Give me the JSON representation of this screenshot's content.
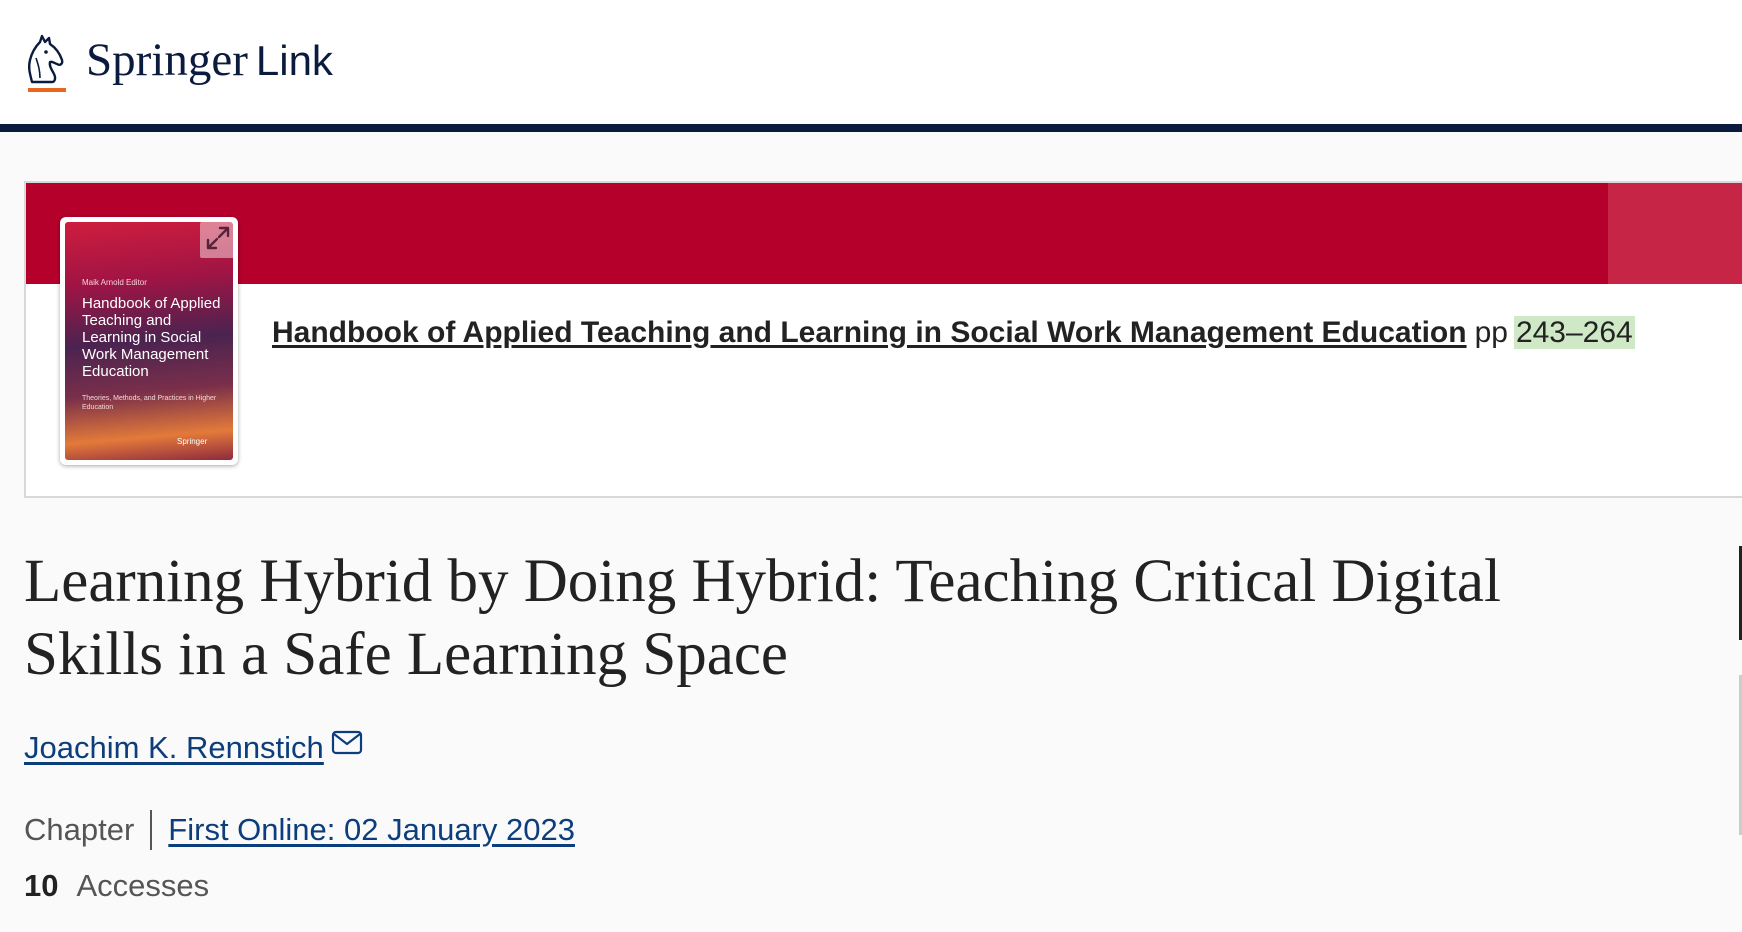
{
  "header": {
    "logo_brand": "Springer",
    "logo_product": "Link",
    "logo_icon": "springer-horse-icon",
    "rule_color": "#0b1b3d",
    "accent_color": "#e8671e"
  },
  "book_banner": {
    "band_color": "#b5002b",
    "cover": {
      "editor": "Maik Arnold Editor",
      "title": "Handbook of Applied Teaching and Learning in Social Work Management Education",
      "subtitle": "Theories, Methods, and Practices in Higher Education",
      "publisher": "Springer",
      "expand_icon": "expand-icon"
    },
    "book_title": "Handbook of Applied Teaching and Learning in Social Work Management Education",
    "pages_prefix": "pp",
    "pages": "243–264"
  },
  "chapter": {
    "title": "Learning Hybrid by Doing Hybrid: Teaching Critical Digital Skills in a Safe Learning Space",
    "author": "Joachim K. Rennstich",
    "author_icon": "envelope-icon",
    "content_type": "Chapter",
    "first_online": "First Online: 02 January 2023",
    "accesses_count": "10",
    "accesses_label": "Accesses",
    "link_color": "#0c3e7d",
    "pages_highlight_color": "#cfe9c7"
  }
}
